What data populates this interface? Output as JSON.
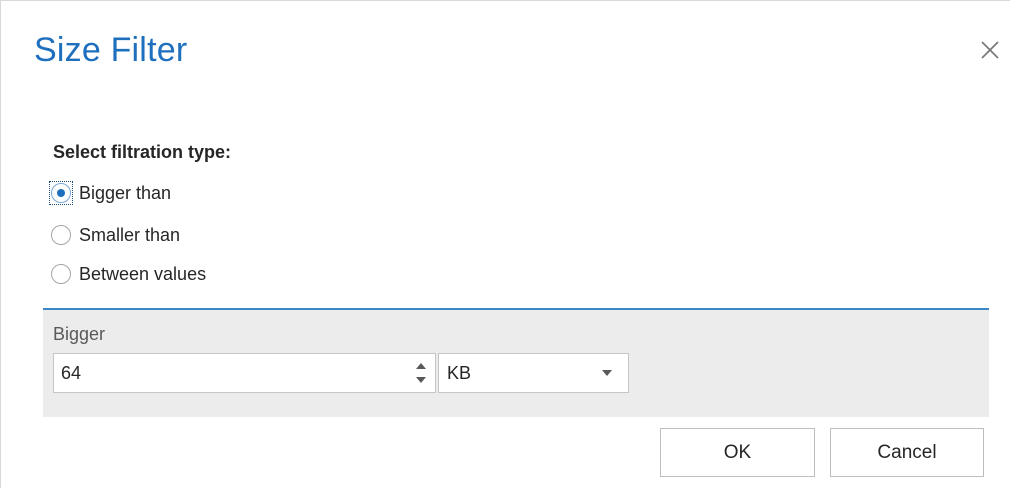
{
  "dialog": {
    "title": "Size Filter",
    "close_icon": "close-icon"
  },
  "filtration": {
    "section_label": "Select filtration type:",
    "options": [
      {
        "label": "Bigger than",
        "checked": true
      },
      {
        "label": "Smaller than",
        "checked": false
      },
      {
        "label": "Between values",
        "checked": false
      }
    ]
  },
  "bigger": {
    "label": "Bigger",
    "value": "64",
    "unit": "KB",
    "spinner_icon": "spinner-arrows-icon",
    "dropdown_icon": "chevron-down-icon"
  },
  "buttons": {
    "ok": "OK",
    "cancel": "Cancel"
  },
  "colors": {
    "title": "#1e6fbd",
    "accent_line": "#3a86c8",
    "panel_bg": "#ececec"
  }
}
